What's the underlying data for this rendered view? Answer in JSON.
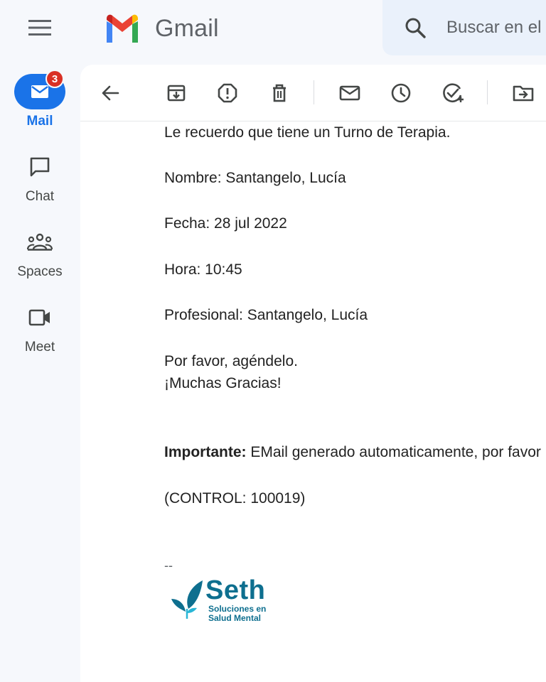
{
  "app": {
    "name": "Gmail"
  },
  "search": {
    "placeholder": "Buscar en el correo"
  },
  "rail": {
    "items": [
      {
        "label": "Mail",
        "badge": "3",
        "icon": "mail-icon",
        "active": true
      },
      {
        "label": "Chat",
        "icon": "chat-icon",
        "active": false
      },
      {
        "label": "Spaces",
        "icon": "spaces-icon",
        "active": false
      },
      {
        "label": "Meet",
        "icon": "meet-icon",
        "active": false
      }
    ]
  },
  "toolbar": {
    "icons": [
      "back-arrow-icon",
      "archive-icon",
      "report-spam-icon",
      "delete-icon",
      "mark-unread-icon",
      "snooze-icon",
      "add-task-icon",
      "move-to-icon"
    ]
  },
  "email": {
    "line1": "Le recuerdo que tiene un Turno de Terapia.",
    "name": "Nombre: Santangelo, Lucía",
    "date": "Fecha: 28 jul 2022",
    "time": "Hora: 10:45",
    "professional": "Profesional: Santangelo, Lucía",
    "please": "Por favor, agéndelo.",
    "thanks": "¡Muchas Gracias!",
    "important_label": "Importante:",
    "important_text": "EMail generado automaticamente, por favor",
    "control": "(CONTROL: 100019)",
    "sig_sep": "--",
    "signature": {
      "brand": "Seth",
      "tagline_1": "Soluciones en",
      "tagline_2": "Salud Mental"
    }
  },
  "colors": {
    "accent": "#1a73e8",
    "badge": "#d93025",
    "brand_teal": "#0e6f8f",
    "brand_cyan": "#29b6d6"
  }
}
